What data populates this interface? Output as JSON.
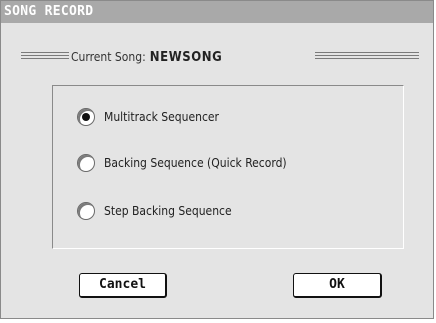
{
  "dialog": {
    "title": "SONG RECORD",
    "current_song_label": "Current Song:",
    "current_song_name": "NEWSONG"
  },
  "options": [
    {
      "label": "Multitrack Sequencer",
      "selected": true
    },
    {
      "label": "Backing Sequence (Quick Record)",
      "selected": false
    },
    {
      "label": "Step Backing Sequence",
      "selected": false
    }
  ],
  "buttons": {
    "cancel_label": "Cancel",
    "ok_label": "OK"
  }
}
